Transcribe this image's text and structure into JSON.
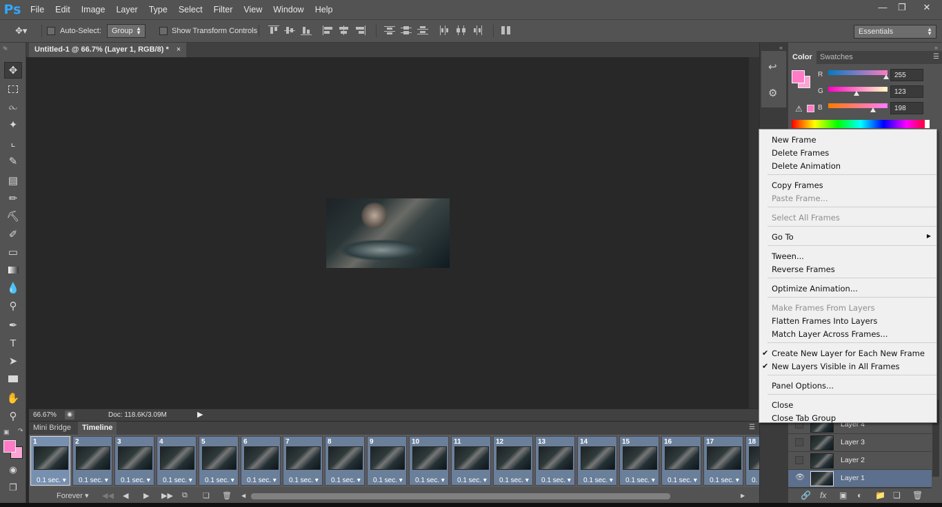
{
  "app": {
    "logo": "Ps",
    "menus": [
      "File",
      "Edit",
      "Image",
      "Layer",
      "Type",
      "Select",
      "Filter",
      "View",
      "Window",
      "Help"
    ],
    "window_controls": [
      "minimize",
      "restore",
      "close"
    ]
  },
  "options_bar": {
    "auto_select_label": "Auto-Select:",
    "auto_select_value": "Group",
    "show_transform_label": "Show Transform Controls",
    "workspace": "Essentials"
  },
  "document": {
    "tab_title": "Untitled-1 @ 66.7% (Layer 1, RGB/8) *",
    "zoom": "66.67%",
    "doc_info": "Doc: 118.6K/3.09M"
  },
  "timeline": {
    "tabs": [
      "Mini Bridge",
      "Timeline"
    ],
    "active_tab": "Timeline",
    "frames": [
      {
        "num": "1",
        "duration": "0.1 sec."
      },
      {
        "num": "2",
        "duration": "0.1 sec."
      },
      {
        "num": "3",
        "duration": "0.1 sec."
      },
      {
        "num": "4",
        "duration": "0.1 sec."
      },
      {
        "num": "5",
        "duration": "0.1 sec."
      },
      {
        "num": "6",
        "duration": "0.1 sec."
      },
      {
        "num": "7",
        "duration": "0.1 sec."
      },
      {
        "num": "8",
        "duration": "0.1 sec."
      },
      {
        "num": "9",
        "duration": "0.1 sec."
      },
      {
        "num": "10",
        "duration": "0.1 sec."
      },
      {
        "num": "11",
        "duration": "0.1 sec."
      },
      {
        "num": "12",
        "duration": "0.1 sec."
      },
      {
        "num": "13",
        "duration": "0.1 sec."
      },
      {
        "num": "14",
        "duration": "0.1 sec."
      },
      {
        "num": "15",
        "duration": "0.1 sec."
      },
      {
        "num": "16",
        "duration": "0.1 sec."
      },
      {
        "num": "17",
        "duration": "0.1 sec."
      },
      {
        "num": "18",
        "duration": "0."
      }
    ],
    "loop": "Forever"
  },
  "color_panel": {
    "tabs": [
      "Color",
      "Swatches"
    ],
    "r_label": "R",
    "g_label": "G",
    "b_label": "B",
    "r": "255",
    "g": "123",
    "b": "198",
    "foreground": "#ff7bc6"
  },
  "layers": [
    {
      "name": "Layer 4",
      "visible": false
    },
    {
      "name": "Layer 3",
      "visible": false
    },
    {
      "name": "Layer 2",
      "visible": false
    },
    {
      "name": "Layer 1",
      "visible": true,
      "selected": true
    }
  ],
  "context_menu": {
    "groups": [
      [
        {
          "label": "New Frame"
        },
        {
          "label": "Delete Frames"
        },
        {
          "label": "Delete Animation"
        }
      ],
      [
        {
          "label": "Copy Frames"
        },
        {
          "label": "Paste Frame...",
          "disabled": true
        }
      ],
      [
        {
          "label": "Select All Frames",
          "disabled": true
        }
      ],
      [
        {
          "label": "Go To",
          "submenu": true
        }
      ],
      [
        {
          "label": "Tween..."
        },
        {
          "label": "Reverse Frames"
        }
      ],
      [
        {
          "label": "Optimize Animation..."
        }
      ],
      [
        {
          "label": "Make Frames From Layers",
          "disabled": true
        },
        {
          "label": "Flatten Frames Into Layers"
        },
        {
          "label": "Match Layer Across Frames..."
        }
      ],
      [
        {
          "label": "Create New Layer for Each New Frame",
          "checked": true
        },
        {
          "label": "New Layers Visible in All Frames",
          "checked": true
        }
      ],
      [
        {
          "label": "Panel Options..."
        }
      ],
      [
        {
          "label": "Close"
        },
        {
          "label": "Close Tab Group"
        }
      ]
    ]
  }
}
